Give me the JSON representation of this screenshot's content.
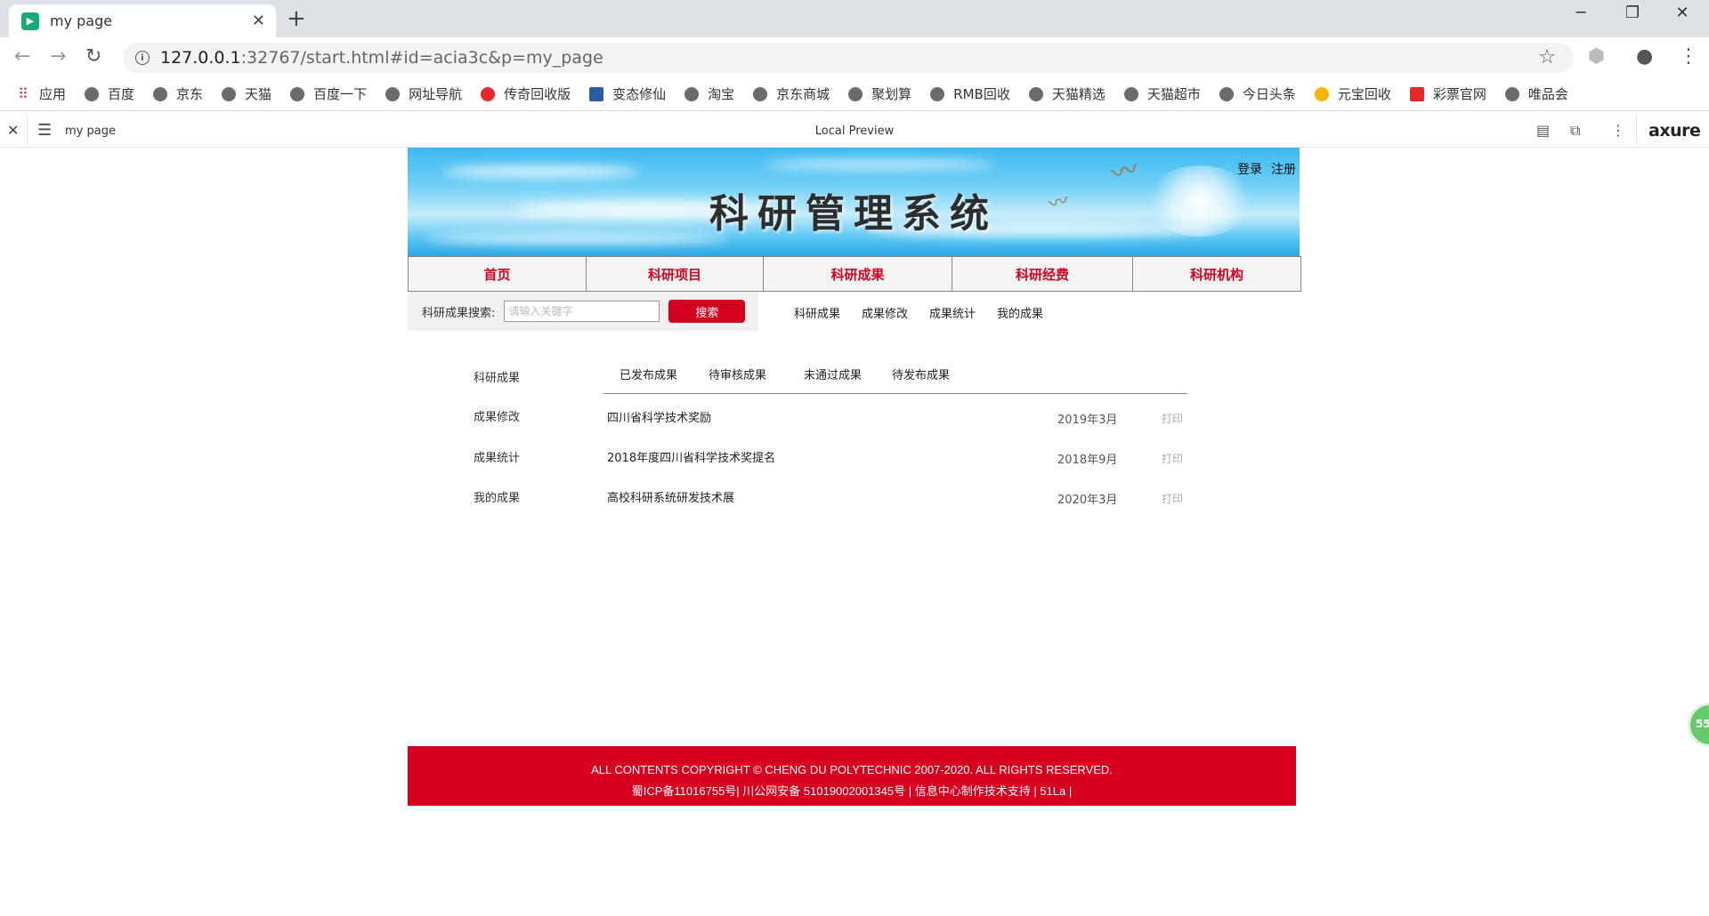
{
  "browser": {
    "tab_title": "my page",
    "favicon": "play-icon",
    "url_host": "127.0.0.1",
    "url_rest": ":32767/start.html#id=acia3c&p=my_page",
    "bookmarks": [
      "应用",
      "百度",
      "京东",
      "天猫",
      "百度一下",
      "网址导航",
      "传奇回收版",
      "变态修仙",
      "淘宝",
      "京东商城",
      "聚划算",
      "RMB回收",
      "天猫精选",
      "天猫超市",
      "今日头条",
      "元宝回收",
      "彩票官网",
      "唯品会"
    ]
  },
  "axure": {
    "page_name": "my page",
    "center_label": "Local Preview",
    "logo": "axure"
  },
  "banner": {
    "title": "科研管理系统",
    "login": "登录",
    "register": "注册"
  },
  "mainnav": [
    "首页",
    "科研项目",
    "科研成果",
    "科研经费",
    "科研机构"
  ],
  "search": {
    "label": "科研成果搜索:",
    "placeholder": "请输入关键字",
    "button": "搜索"
  },
  "sublinks": [
    "科研成果",
    "成果修改",
    "成果统计",
    "我的成果"
  ],
  "sidebar": [
    "科研成果",
    "成果修改",
    "成果统计",
    "我的成果"
  ],
  "content_tabs": [
    "已发布成果",
    "待审核成果",
    "未通过成果",
    "待发布成果"
  ],
  "rows": [
    {
      "title": "四川省科学技术奖励",
      "date": "2019年3月",
      "action": "打印"
    },
    {
      "title": "2018年度四川省科学技术奖提名",
      "date": "2018年9月",
      "action": "打印"
    },
    {
      "title": "高校科研系统研发技术展",
      "date": "2020年3月",
      "action": "打印"
    }
  ],
  "footer": {
    "line1": "ALL CONTENTS COPYRIGHT © CHENG DU POLYTECHNIC 2007-2020. ALL RIGHTS RESERVED.",
    "line2": "蜀ICP备11016755号| 川公网安备 51019002001345号    |    信息中心制作技术支持    |    51La |"
  },
  "float_badge": "55",
  "colors": {
    "accent": "#d4001f",
    "footer": "#d8001f"
  }
}
